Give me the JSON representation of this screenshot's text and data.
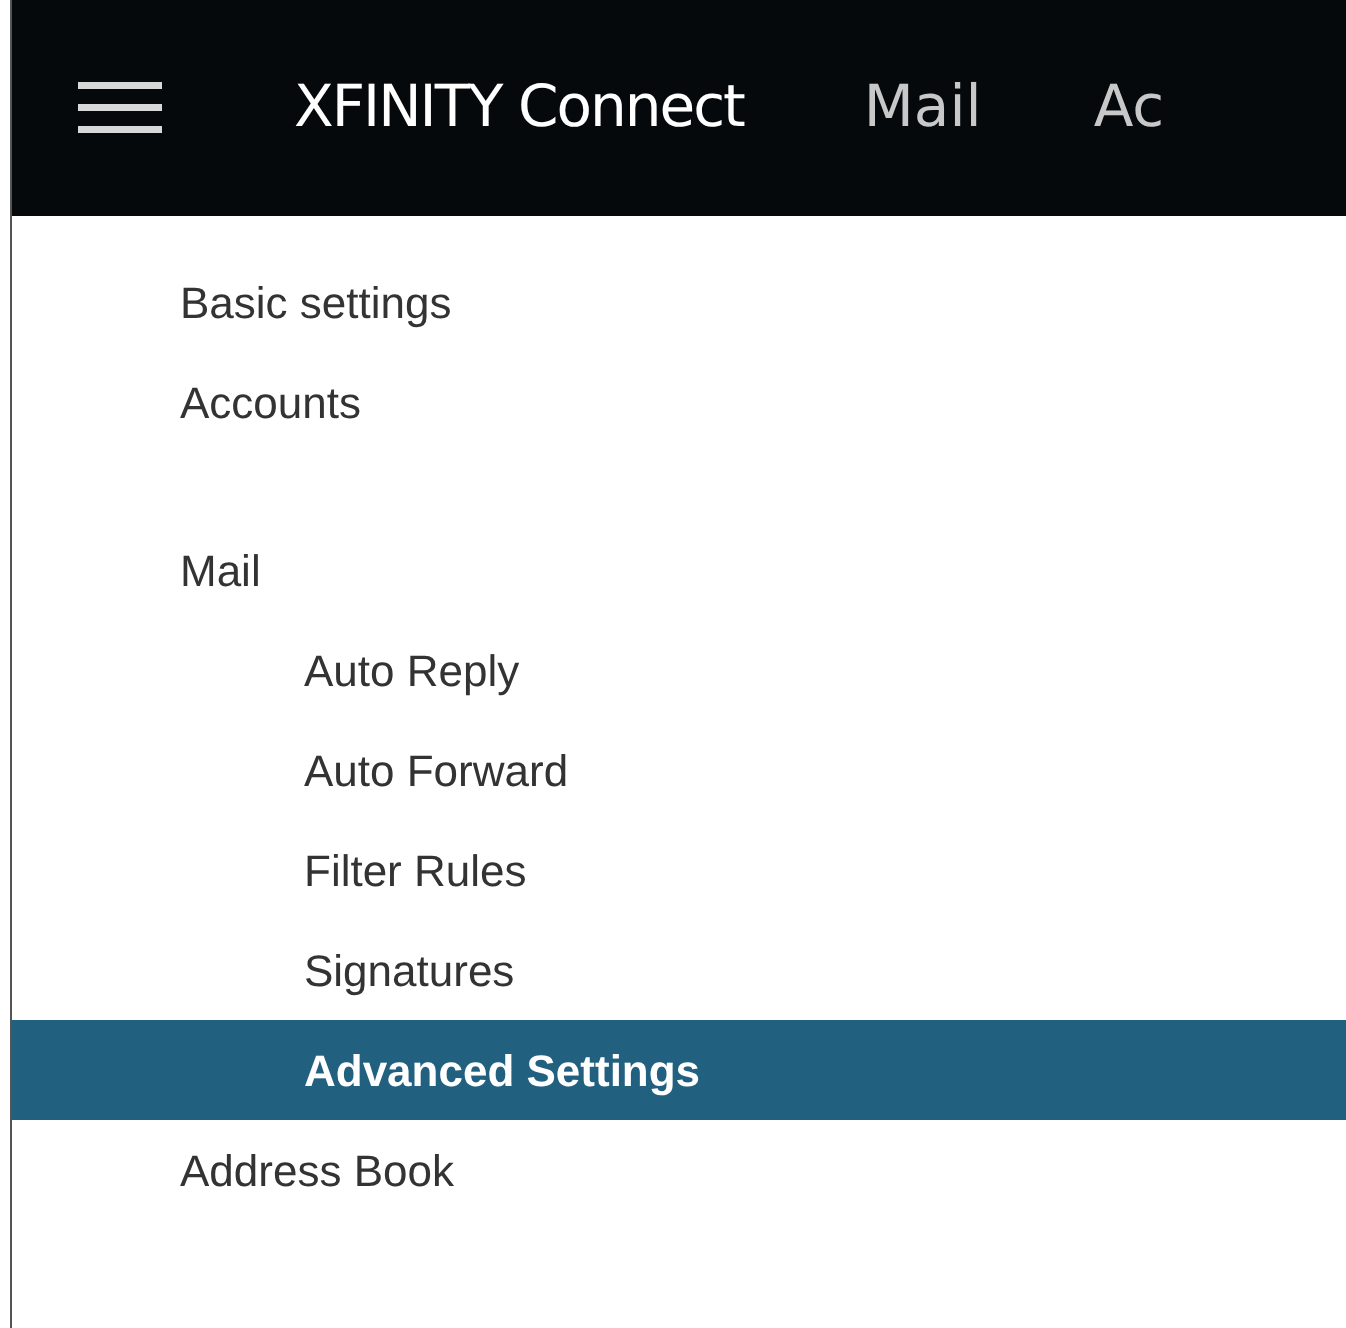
{
  "header": {
    "title": "XFINITY Connect",
    "nav": [
      {
        "label": "Mail"
      },
      {
        "label": "Ac"
      }
    ]
  },
  "menu": [
    {
      "label": "Basic settings",
      "selected": false
    },
    {
      "label": "Accounts",
      "selected": false
    },
    {
      "label": "Mail",
      "selected": false,
      "children": [
        {
          "label": "Auto Reply",
          "selected": false
        },
        {
          "label": "Auto Forward",
          "selected": false
        },
        {
          "label": "Filter Rules",
          "selected": false
        },
        {
          "label": "Signatures",
          "selected": false
        },
        {
          "label": "Advanced Settings",
          "selected": true
        }
      ]
    },
    {
      "label": "Address Book",
      "selected": false
    }
  ]
}
